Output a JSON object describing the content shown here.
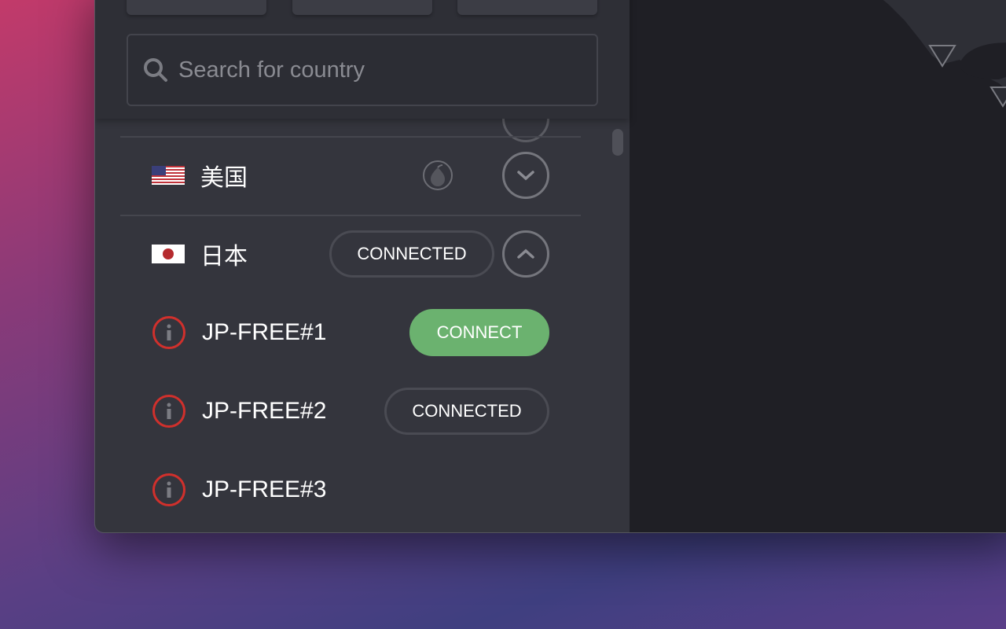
{
  "search": {
    "placeholder": "Search for country",
    "value": ""
  },
  "countries": [
    {
      "name": "美国",
      "flag": "us-flag",
      "expanded": false,
      "badge": "tor-onion-icon"
    },
    {
      "name": "日本",
      "flag": "jp-flag",
      "expanded": true,
      "status": "CONNECTED"
    }
  ],
  "servers": [
    {
      "name": "JP-FREE#1",
      "action": "CONNECT"
    },
    {
      "name": "JP-FREE#2",
      "action": "CONNECTED"
    },
    {
      "name": "JP-FREE#3",
      "action": ""
    }
  ],
  "colors": {
    "connect": "#6bb26f",
    "load": "#d0302c",
    "map_land": "#2e2f36",
    "map_sea": "#1f1f25"
  }
}
